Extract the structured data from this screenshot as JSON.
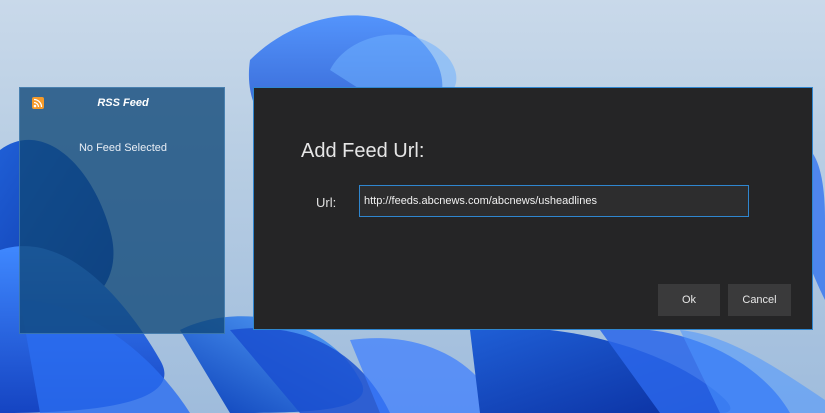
{
  "colors": {
    "dialog_bg": "#252526",
    "accent_border": "#2f86cf",
    "widget_bg": "#104878",
    "rss_orange": "#f59a2a",
    "button_bg": "#3a3a3b"
  },
  "rss_widget": {
    "icon": "rss-icon",
    "title": "RSS Feed",
    "status": "No Feed Selected"
  },
  "dialog": {
    "title": "Add Feed Url:",
    "url_label": "Url:",
    "url_value": "http://feeds.abcnews.com/abcnews/usheadlines",
    "ok_label": "Ok",
    "cancel_label": "Cancel"
  }
}
